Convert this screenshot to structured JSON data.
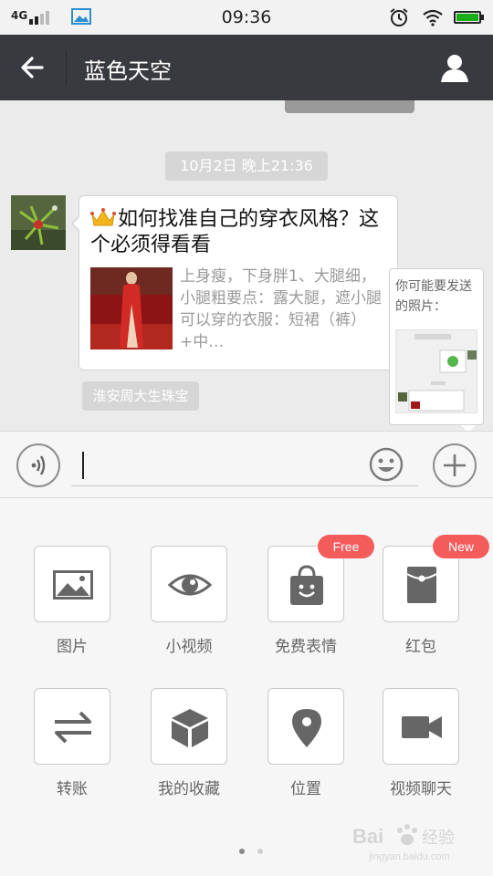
{
  "status_bar": {
    "network": "4G",
    "time": "09:36",
    "icons": [
      "signal-icon",
      "gallery-icon",
      "alarm-icon",
      "wifi-icon",
      "battery-icon"
    ],
    "battery_color": "#1aad19"
  },
  "header": {
    "title": "蓝色天空",
    "back_icon": "back-arrow-icon",
    "profile_icon": "person-icon",
    "bg_color": "#393a3f"
  },
  "chat": {
    "timestamp": "10月2日 晚上21:36",
    "message": {
      "title": "如何找准自己的穿衣风格？这个必须得看看",
      "description": "上身瘦，下身胖1、大腿细，小腿粗要点：露大腿，遮小腿可以穿的衣服：短裙（裤）+中…",
      "source": "淮安周大生珠宝"
    },
    "suggestion": {
      "text": "你可能要发送的照片："
    }
  },
  "input_bar": {
    "value": "",
    "icons": [
      "voice-icon",
      "emoji-icon",
      "plus-icon"
    ]
  },
  "panel": {
    "tools": [
      {
        "label": "图片",
        "icon": "image-icon",
        "badge": ""
      },
      {
        "label": "小视频",
        "icon": "eye-icon",
        "badge": ""
      },
      {
        "label": "免费表情",
        "icon": "sticker-bag-icon",
        "badge": "Free"
      },
      {
        "label": "红包",
        "icon": "red-packet-icon",
        "badge": "New"
      },
      {
        "label": "转账",
        "icon": "transfer-icon",
        "badge": ""
      },
      {
        "label": "我的收藏",
        "icon": "box-icon",
        "badge": ""
      },
      {
        "label": "位置",
        "icon": "location-pin-icon",
        "badge": ""
      },
      {
        "label": "视频聊天",
        "icon": "video-camera-icon",
        "badge": ""
      }
    ],
    "badge_color": "#f45c5c",
    "page_count": 2,
    "current_page": 1,
    "watermark": "Bai 经验"
  }
}
